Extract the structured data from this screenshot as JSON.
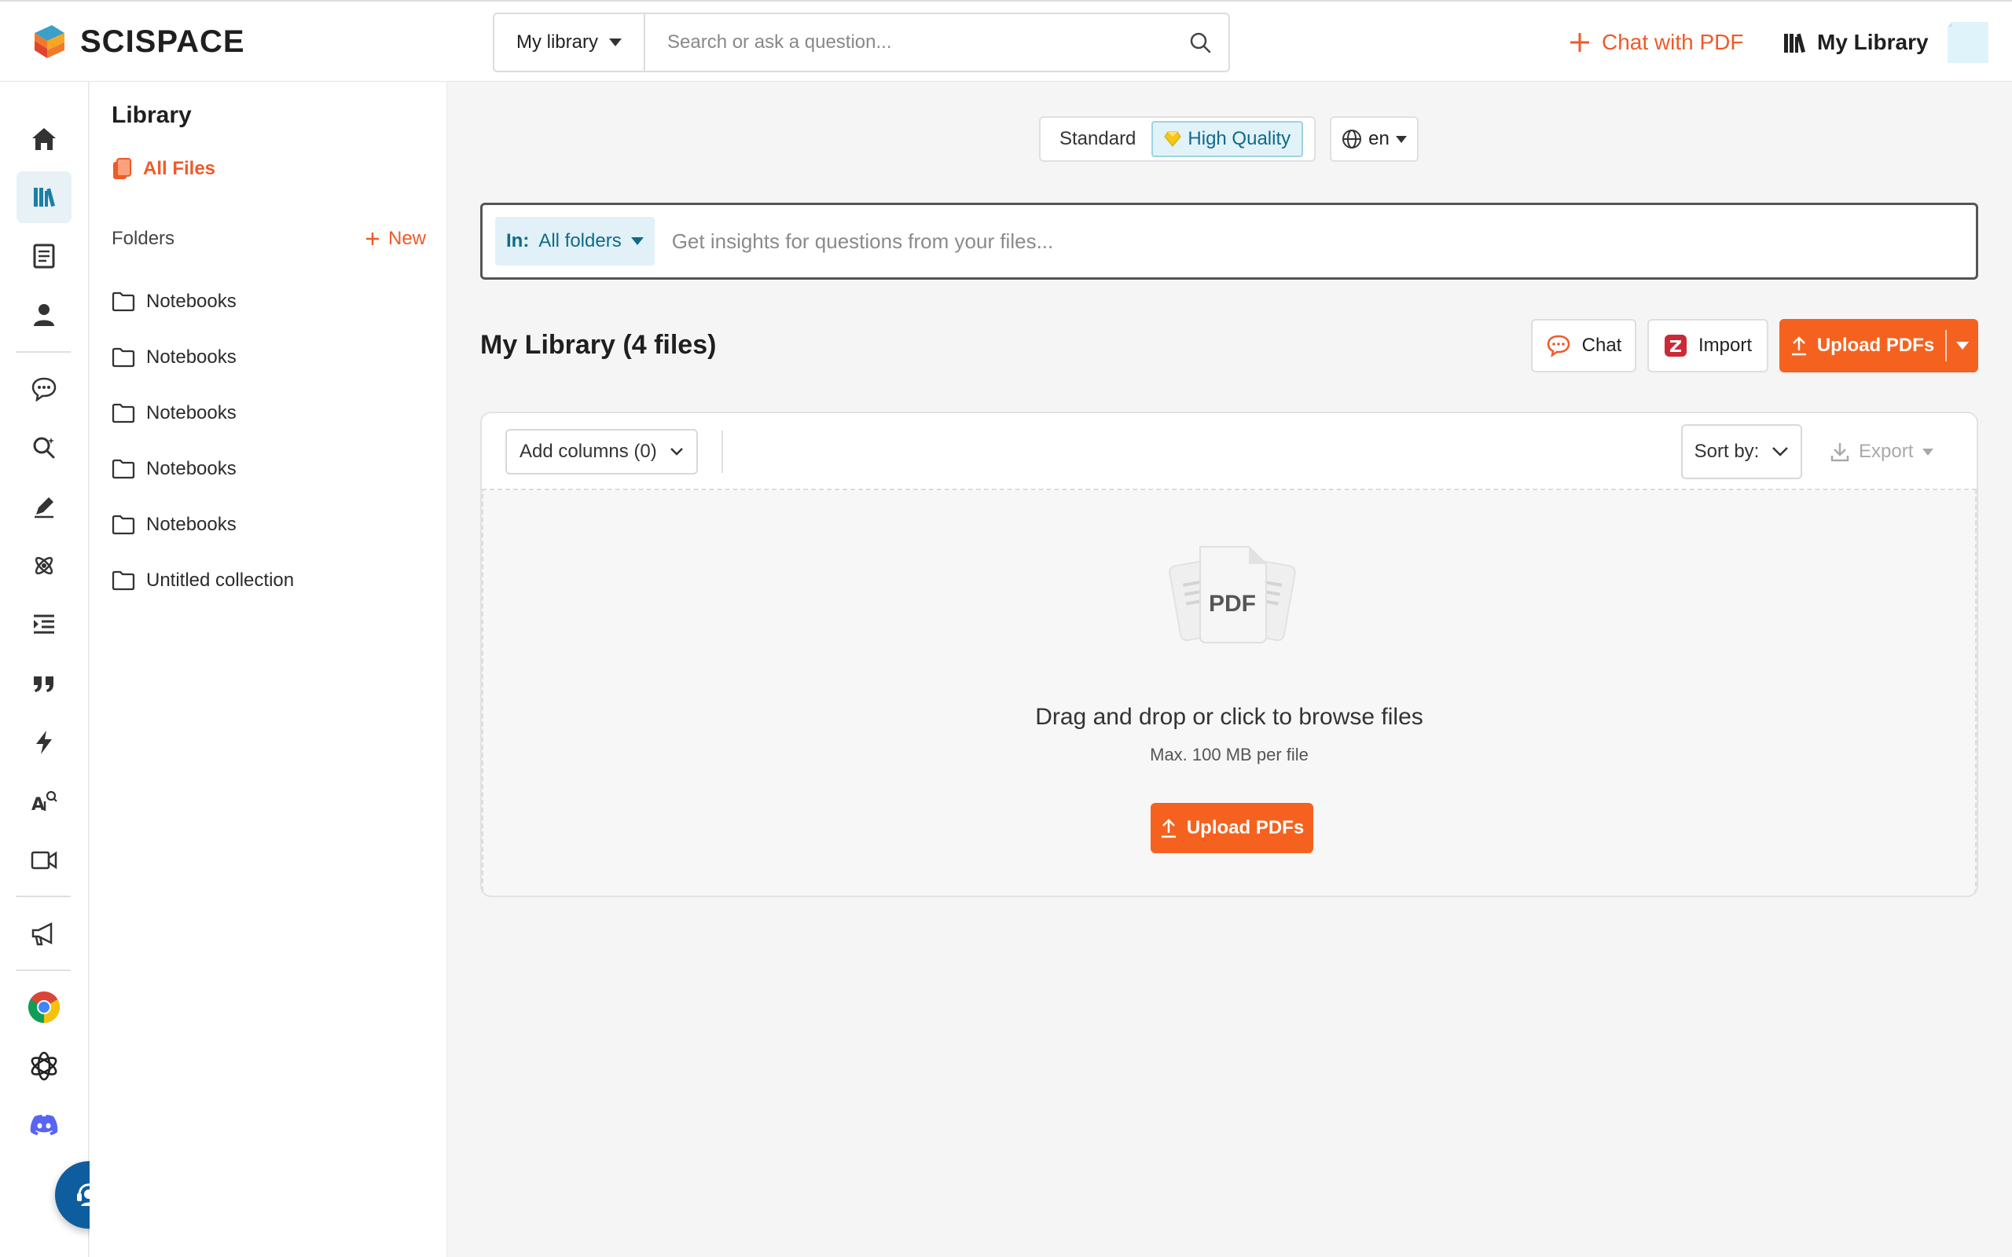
{
  "app": {
    "name": "SCISPACE"
  },
  "header": {
    "search_scope": "My library",
    "search_placeholder": "Search or ask a question...",
    "chat_with_pdf": "Chat with PDF",
    "my_library": "My Library"
  },
  "rail": {
    "items": [
      "home",
      "library",
      "notebook",
      "profile",
      "chat",
      "literature-search",
      "writer",
      "ai-detector",
      "outline",
      "citation",
      "extract",
      "paraphrase",
      "video",
      "announcements",
      "chrome-extension",
      "chatgpt-plugin",
      "discord"
    ]
  },
  "sidebar": {
    "title": "Library",
    "all_files": "All Files",
    "folders_label": "Folders",
    "new_label": "New",
    "folders": [
      {
        "label": "Notebooks"
      },
      {
        "label": "Notebooks"
      },
      {
        "label": "Notebooks"
      },
      {
        "label": "Notebooks"
      },
      {
        "label": "Notebooks"
      },
      {
        "label": "Untitled collection"
      }
    ]
  },
  "quality": {
    "standard": "Standard",
    "high": "High Quality",
    "selected": "High Quality"
  },
  "language": {
    "value": "en"
  },
  "insight": {
    "scope_label": "In:",
    "scope_value": "All folders",
    "placeholder": "Get insights for questions from your files..."
  },
  "library": {
    "heading": "My Library (4 files)",
    "chat_button": "Chat",
    "import_button": "Import",
    "upload_button": "Upload PDFs"
  },
  "table": {
    "add_columns": "Add columns (0)",
    "sort_by": "Sort by:",
    "export": "Export"
  },
  "dropzone": {
    "pdf_label": "PDF",
    "title": "Drag and drop or click to browse files",
    "subtitle": "Max. 100 MB per file",
    "upload_button": "Upload PDFs"
  },
  "colors": {
    "accent": "#f5621f",
    "teal": "#0f6a8a",
    "help": "#0e5d9f"
  }
}
